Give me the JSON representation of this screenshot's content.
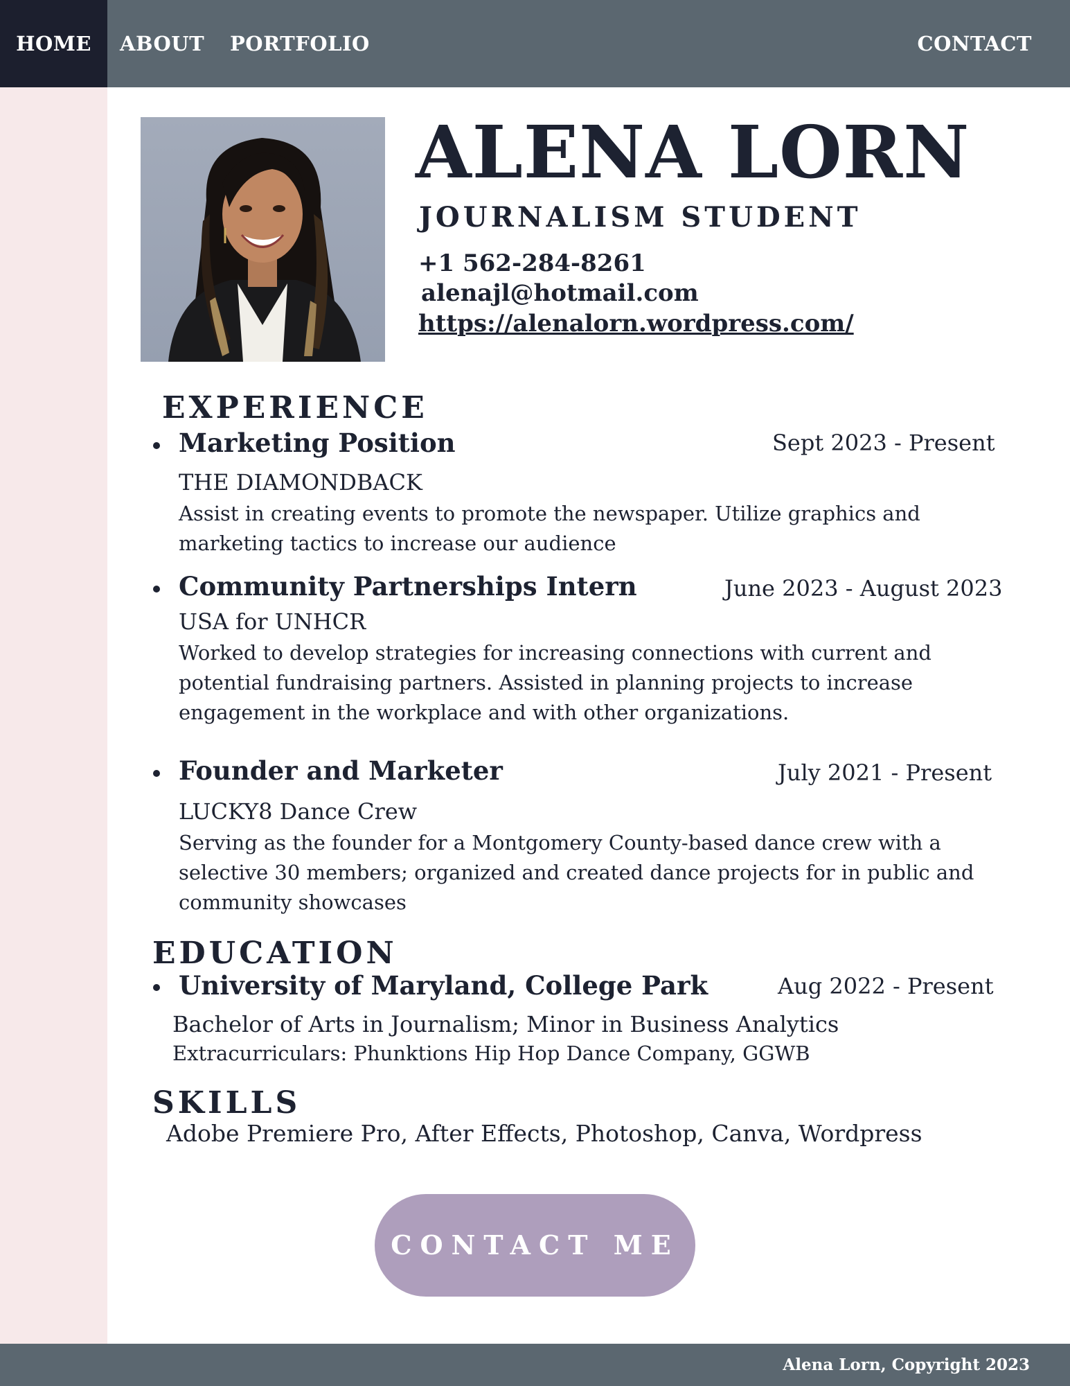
{
  "nav": {
    "home": "HOME",
    "about": "ABOUT",
    "portfolio": "PORTFOLIO",
    "contact": "CONTACT"
  },
  "profile": {
    "name": "ALENA LORN",
    "title": "JOURNALISM STUDENT",
    "phone": "+1 562-284-8261",
    "email": "alenajl@hotmail.com",
    "website": "https://alenalorn.wordpress.com/"
  },
  "experience": {
    "heading": "EXPERIENCE",
    "items": [
      {
        "role": "Marketing Position",
        "dates": "Sept 2023 - Present",
        "org": "THE DIAMONDBACK",
        "description": "Assist in creating events to promote the newspaper. Utilize graphics and marketing tactics to increase our audience"
      },
      {
        "role": "Community Partnerships Intern",
        "dates": "June 2023 - August 2023",
        "org": "USA for UNHCR",
        "description": "Worked to develop strategies for increasing connections with current and potential fundraising partners. Assisted in planning projects to increase engagement in the workplace and with other organizations."
      },
      {
        "role": "Founder and Marketer",
        "dates": "July 2021 - Present",
        "org": "LUCKY8 Dance Crew",
        "description": "Serving as the founder for a Montgomery County-based dance crew with a selective 30  members; organized and created dance projects for in public and community showcases"
      }
    ]
  },
  "education": {
    "heading": "EDUCATION",
    "school": "University of Maryland, College Park",
    "dates": "Aug 2022 - Present",
    "degree": "Bachelor of Arts in Journalism; Minor in Business Analytics",
    "extracurriculars": "Extracurriculars: Phunktions Hip Hop Dance Company, GGWB"
  },
  "skills": {
    "heading": "SKILLS",
    "list": "Adobe Premiere Pro, After Effects, Photoshop, Canva, Wordpress"
  },
  "cta": {
    "label": "CONTACT ME"
  },
  "footer": {
    "copyright": "Alena Lorn, Copyright 2023"
  },
  "colors": {
    "nav_bg": "#5b6770",
    "nav_active_bg": "#1c1f2e",
    "sidebar_bg": "#f7e9ea",
    "text": "#1d2231",
    "button_bg": "#ae9ebc"
  }
}
